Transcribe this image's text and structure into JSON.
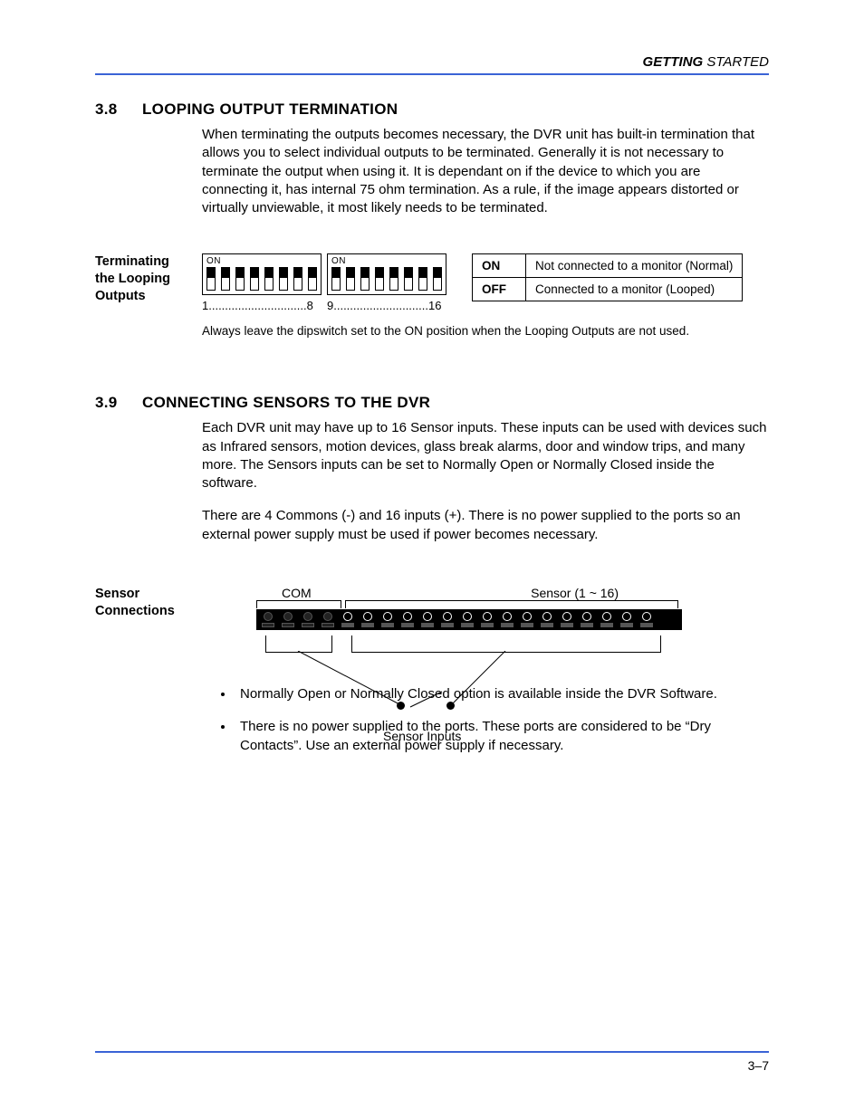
{
  "header": {
    "bold": "GETTING",
    "rest": " STARTED"
  },
  "sec38": {
    "num": "3.8",
    "title": "LOOPING OUTPUT TERMINATION",
    "body": "When terminating the outputs becomes necessary, the DVR unit has built-in termination that allows you to select individual outputs to be terminated. Generally it is not necessary to terminate the output when using it. It is dependant on if the device to which you are connecting it, has internal 75 ohm termination. As a rule, if the image appears distorted or virtually unviewable, it most likely needs to be terminated.",
    "side": "Terminating the Looping Outputs",
    "dip": {
      "on_label": "ON",
      "range1": "1..............................8",
      "range2": "9.............................16"
    },
    "table": {
      "on_k": "ON",
      "on_v": "Not connected to a monitor (Normal)",
      "off_k": "OFF",
      "off_v": "Connected to a monitor (Looped)"
    },
    "note": "Always leave the dipswitch set to the ON position when the Looping Outputs are not used."
  },
  "sec39": {
    "num": "3.9",
    "title": "CONNECTING SENSORS TO THE DVR",
    "body1": "Each DVR unit may have up to 16 Sensor inputs. These inputs can be used with devices such as Infrared sensors, motion devices, glass break alarms, door and window trips, and many more. The Sensors inputs can be set to Normally Open or Normally Closed inside the software.",
    "body2": "There are 4 Commons (-) and 16 inputs (+). There is no power supplied to the ports so an external power supply must be used if power becomes necessary.",
    "side": "Sensor Connections",
    "diagram": {
      "com": "COM",
      "sensor": "Sensor (1 ~ 16)",
      "caption": "Sensor Inputs"
    },
    "bullets": [
      "Normally Open or Normally Closed option is available inside the DVR Software.",
      "There is no power supplied to the ports. These ports are considered to be “Dry Contacts”. Use an external power supply if necessary."
    ]
  },
  "footer": "3–7"
}
